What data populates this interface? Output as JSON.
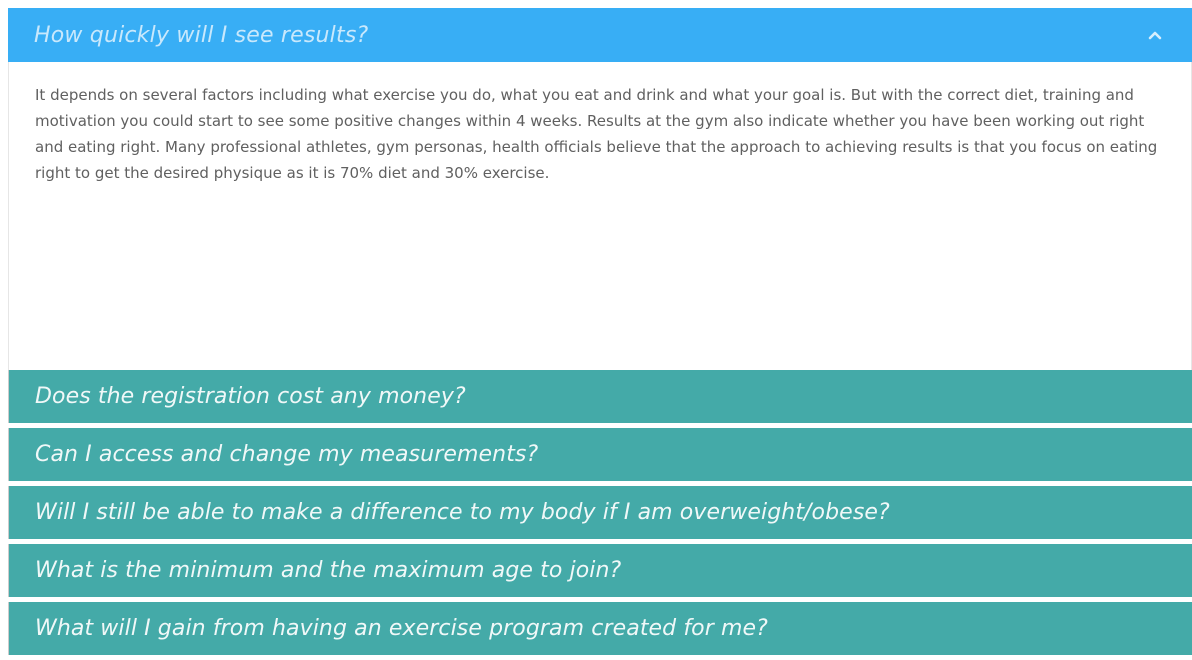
{
  "faq": {
    "active": {
      "question": "How quickly will I see results?",
      "answer": "It depends on several factors including what exercise you do, what you eat and drink and what your goal is. But with the correct diet, training and motivation you could start to see some positive changes within 4 weeks. Results at the gym also indicate whether you have been working out right and eating right. Many professional athletes, gym personas, health officials believe that the approach to achieving results is that you focus on eating right to get the desired physique as it is 70% diet and 30% exercise."
    },
    "items": [
      {
        "question": "Does the registration cost any money?"
      },
      {
        "question": "Can I access and change my measurements?"
      },
      {
        "question": "Will I still be able to make a difference to my body if I am overweight/obese?"
      },
      {
        "question": "What is the minimum and the maximum age to join?"
      },
      {
        "question": "What will I gain from having an exercise program created for me?"
      }
    ]
  },
  "colors": {
    "active_header": "#38aef5",
    "collapsed_item": "#44aaa8",
    "answer_text": "#606060"
  },
  "icons": {
    "collapse": "chevron-up-icon"
  }
}
